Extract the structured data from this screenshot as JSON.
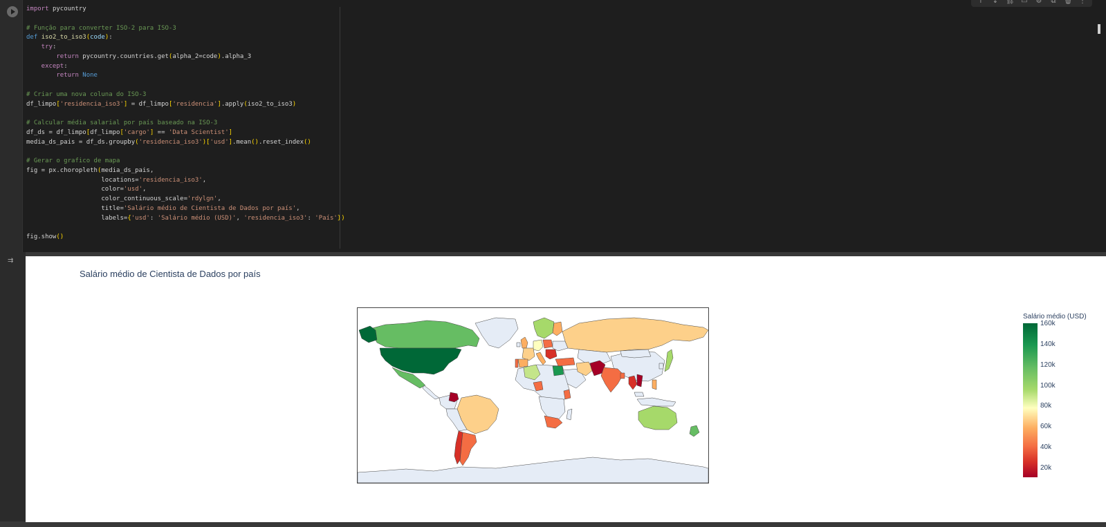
{
  "cell_toolbar": {
    "icons": [
      "arrow-up-icon",
      "arrow-down-icon",
      "link-icon",
      "comment-icon",
      "gear-icon",
      "mirror-icon",
      "delete-icon",
      "more-icon"
    ]
  },
  "code_cell": {
    "lines": [
      [
        {
          "t": "import ",
          "c": "tok-kw"
        },
        {
          "t": "pycountry"
        }
      ],
      [
        {
          "t": ""
        }
      ],
      [
        {
          "t": "# Função para converter ISO-2 para ISO-3",
          "c": "tok-cm"
        }
      ],
      [
        {
          "t": "def ",
          "c": "tok-def"
        },
        {
          "t": "iso2_to_iso3",
          "c": "tok-fn"
        },
        {
          "t": "(",
          "c": "tok-pr"
        },
        {
          "t": "code",
          "c": "tok-id"
        },
        {
          "t": ")",
          "c": "tok-pr"
        },
        {
          "t": ":"
        }
      ],
      [
        {
          "t": "    try",
          "c": "tok-kw"
        },
        {
          "t": ":"
        }
      ],
      [
        {
          "t": "        return ",
          "c": "tok-kw"
        },
        {
          "t": "pycountry.countries.get"
        },
        {
          "t": "(",
          "c": "tok-pr"
        },
        {
          "t": "alpha_2=code"
        },
        {
          "t": ")",
          "c": "tok-pr"
        },
        {
          "t": ".alpha_3"
        }
      ],
      [
        {
          "t": "    except",
          "c": "tok-kw"
        },
        {
          "t": ":"
        }
      ],
      [
        {
          "t": "        return ",
          "c": "tok-kw"
        },
        {
          "t": "None",
          "c": "tok-nn"
        }
      ],
      [
        {
          "t": ""
        }
      ],
      [
        {
          "t": "# Criar uma nova coluna do ISO-3",
          "c": "tok-cm"
        }
      ],
      [
        {
          "t": "df_limpo"
        },
        {
          "t": "[",
          "c": "tok-pr"
        },
        {
          "t": "'residencia_iso3'",
          "c": "tok-st"
        },
        {
          "t": "]",
          "c": "tok-pr"
        },
        {
          "t": " = df_limpo"
        },
        {
          "t": "[",
          "c": "tok-pr"
        },
        {
          "t": "'residencia'",
          "c": "tok-st"
        },
        {
          "t": "]",
          "c": "tok-pr"
        },
        {
          "t": ".apply"
        },
        {
          "t": "(",
          "c": "tok-pr"
        },
        {
          "t": "iso2_to_iso3"
        },
        {
          "t": ")",
          "c": "tok-pr"
        }
      ],
      [
        {
          "t": ""
        }
      ],
      [
        {
          "t": "# Calcular média salarial por país baseado na ISO-3",
          "c": "tok-cm"
        }
      ],
      [
        {
          "t": "df_ds = df_limpo"
        },
        {
          "t": "[",
          "c": "tok-pr"
        },
        {
          "t": "df_limpo"
        },
        {
          "t": "[",
          "c": "tok-pr"
        },
        {
          "t": "'cargo'",
          "c": "tok-st"
        },
        {
          "t": "]",
          "c": "tok-pr"
        },
        {
          "t": " == "
        },
        {
          "t": "'Data Scientist'",
          "c": "tok-st"
        },
        {
          "t": "]",
          "c": "tok-pr"
        }
      ],
      [
        {
          "t": "media_ds_pais = df_ds.groupby"
        },
        {
          "t": "(",
          "c": "tok-pr"
        },
        {
          "t": "'residencia_iso3'",
          "c": "tok-st"
        },
        {
          "t": ")",
          "c": "tok-pr"
        },
        {
          "t": "[",
          "c": "tok-pr"
        },
        {
          "t": "'usd'",
          "c": "tok-st"
        },
        {
          "t": "]",
          "c": "tok-pr"
        },
        {
          "t": ".mean"
        },
        {
          "t": "()",
          "c": "tok-pr"
        },
        {
          "t": ".reset_index"
        },
        {
          "t": "()",
          "c": "tok-pr"
        }
      ],
      [
        {
          "t": ""
        }
      ],
      [
        {
          "t": "# Gerar o grafico de mapa",
          "c": "tok-cm"
        }
      ],
      [
        {
          "t": "fig = px.choropleth"
        },
        {
          "t": "(",
          "c": "tok-pr"
        },
        {
          "t": "media_ds_pais,"
        }
      ],
      [
        {
          "t": "                    locations="
        },
        {
          "t": "'residencia_iso3'",
          "c": "tok-st"
        },
        {
          "t": ","
        }
      ],
      [
        {
          "t": "                    color="
        },
        {
          "t": "'usd'",
          "c": "tok-st"
        },
        {
          "t": ","
        }
      ],
      [
        {
          "t": "                    color_continuous_scale="
        },
        {
          "t": "'rdylgn'",
          "c": "tok-st"
        },
        {
          "t": ","
        }
      ],
      [
        {
          "t": "                    title="
        },
        {
          "t": "'Salário médio de Cientista de Dados por país'",
          "c": "tok-st"
        },
        {
          "t": ","
        }
      ],
      [
        {
          "t": "                    labels="
        },
        {
          "t": "{",
          "c": "tok-pr"
        },
        {
          "t": "'usd'",
          "c": "tok-st"
        },
        {
          "t": ": "
        },
        {
          "t": "'Salário médio (USD)'",
          "c": "tok-st"
        },
        {
          "t": ", "
        },
        {
          "t": "'residencia_iso3'",
          "c": "tok-st"
        },
        {
          "t": ": "
        },
        {
          "t": "'País'",
          "c": "tok-st"
        },
        {
          "t": "}",
          "c": "tok-pr"
        },
        {
          "t": ")",
          "c": "tok-pr"
        }
      ],
      [
        {
          "t": ""
        }
      ],
      [
        {
          "t": "fig.show"
        },
        {
          "t": "()",
          "c": "tok-pr"
        }
      ]
    ]
  },
  "output": {
    "title": "Salário médio de Cientista de Dados por país",
    "colorbar": {
      "title": "Salário médio (USD)",
      "ticks": [
        "160k",
        "140k",
        "120k",
        "100k",
        "80k",
        "60k",
        "40k",
        "20k"
      ]
    },
    "colors": {
      "no_data": "#e5ecf6",
      "scale": [
        "#a50026",
        "#d73027",
        "#f46d43",
        "#fdae61",
        "#ffffbf",
        "#a6d96a",
        "#66bd63",
        "#1a9850",
        "#006837"
      ]
    }
  }
}
